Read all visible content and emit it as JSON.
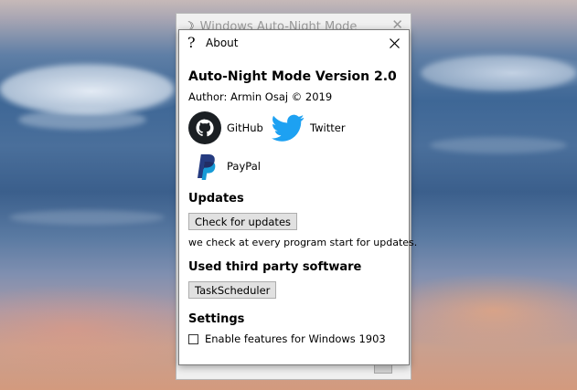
{
  "background_window": {
    "title": "Windows Auto-Night Mode",
    "close_glyph": "✕"
  },
  "dialog": {
    "help_glyph": "?",
    "title": "About",
    "heading": "Auto-Night Mode Version 2.0",
    "author": "Author: Armin Osaj © 2019",
    "links": {
      "github": "GitHub",
      "twitter": "Twitter",
      "paypal": "PayPal"
    },
    "updates": {
      "heading": "Updates",
      "button": "Check for updates",
      "note": "we check at every program start for updates."
    },
    "third_party": {
      "heading": "Used third party software",
      "button": "TaskScheduler"
    },
    "settings": {
      "heading": "Settings",
      "checkbox_label": "Enable features for Windows 1903",
      "checkbox_checked": false
    }
  },
  "colors": {
    "twitter": "#1da1f2",
    "paypal_dark": "#253b80",
    "paypal_light": "#179bd7",
    "github": "#1b1f23"
  }
}
